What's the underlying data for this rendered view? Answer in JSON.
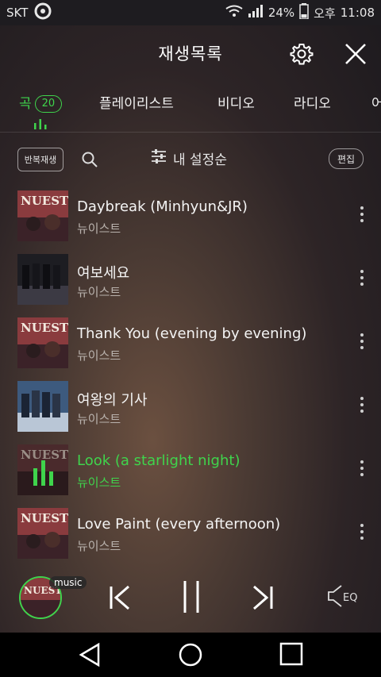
{
  "status_bar": {
    "carrier": "SKT",
    "battery": "24%",
    "ampm": "오후",
    "time": "11:08"
  },
  "header": {
    "title": "재생목록"
  },
  "tabs": [
    {
      "label": "곡",
      "count": "20",
      "active": true
    },
    {
      "label": "플레이리스트"
    },
    {
      "label": "비디오"
    },
    {
      "label": "라디오"
    },
    {
      "label": "어"
    }
  ],
  "toolbar": {
    "repeat_label": "반복재생",
    "sort_label": "내 설정순",
    "edit_label": "편집"
  },
  "songs": [
    {
      "title": "Daybreak (Minhyun&JR)",
      "artist": "뉴이스트",
      "cover": "nuest-red"
    },
    {
      "title": "여보세요",
      "artist": "뉴이스트",
      "cover": "group-dark"
    },
    {
      "title": "Thank You (evening by evening)",
      "artist": "뉴이스트",
      "cover": "nuest-red"
    },
    {
      "title": "여왕의 기사",
      "artist": "뉴이스트",
      "cover": "group-blue"
    },
    {
      "title": "Look (a starlight night)",
      "artist": "뉴이스트",
      "cover": "nuest-dark",
      "playing": true
    },
    {
      "title": "Love Paint (every afternoon)",
      "artist": "뉴이스트",
      "cover": "nuest-red"
    }
  ],
  "player": {
    "tag": "music",
    "eq_label": "EQ"
  },
  "colors": {
    "accent": "#3fd44c"
  }
}
